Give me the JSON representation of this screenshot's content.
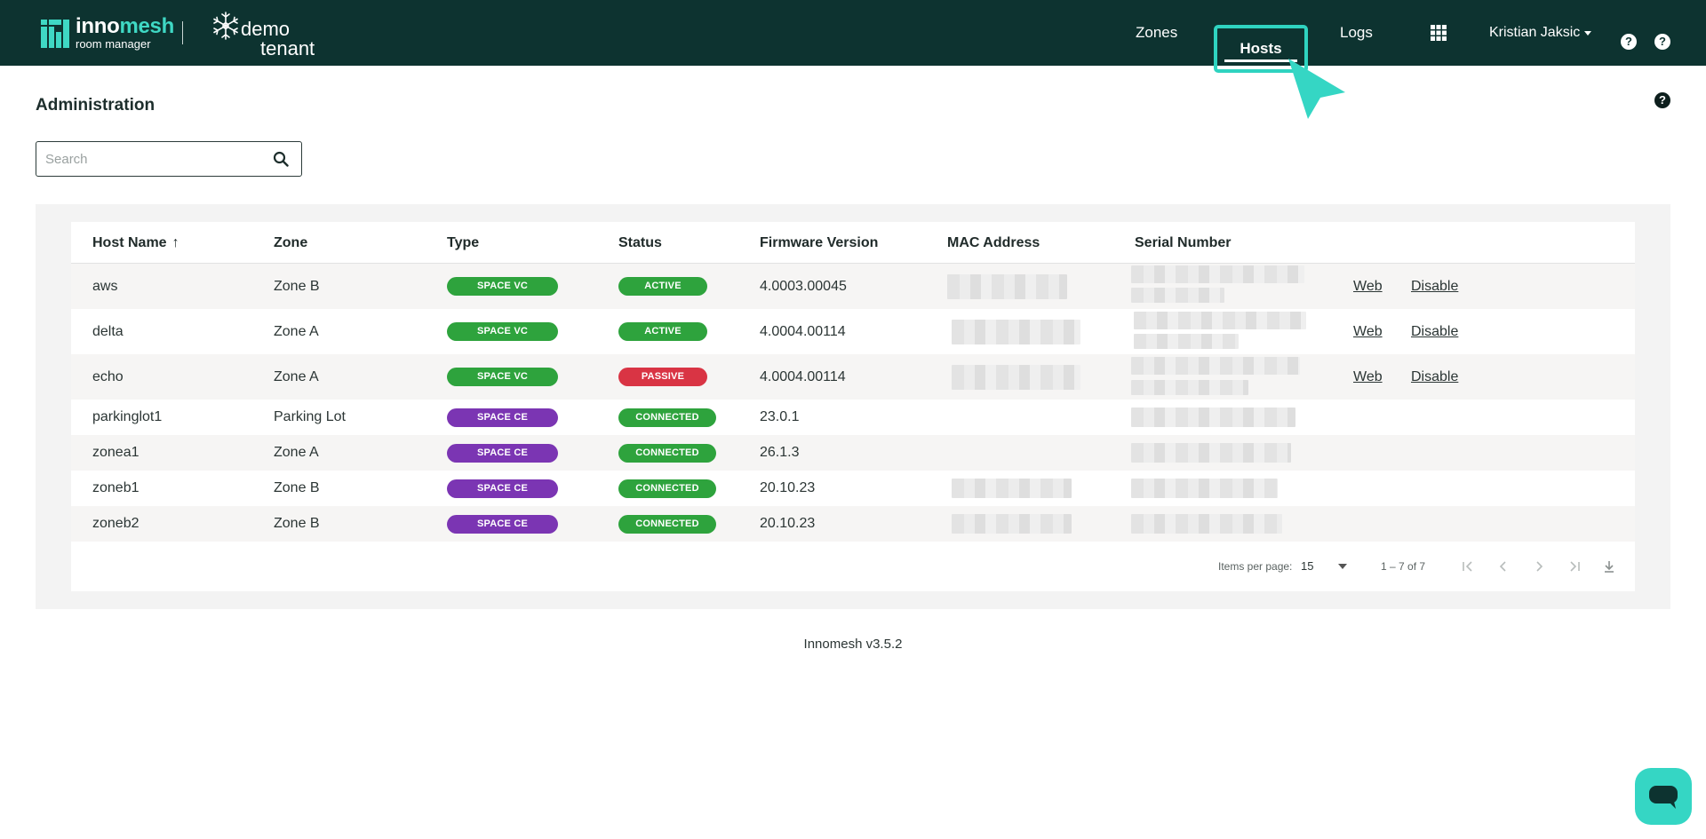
{
  "header": {
    "brand_name_part1": "inno",
    "brand_name_part2": "mesh",
    "brand_sub": "room manager",
    "tenant_line1": "demo",
    "tenant_line2": "tenant",
    "nav": {
      "zones": "Zones",
      "hosts": "Hosts",
      "logs": "Logs"
    },
    "user": "Kristian Jaksic",
    "help_glyph": "?"
  },
  "page": {
    "title": "Administration",
    "help_glyph": "?"
  },
  "search": {
    "placeholder": "Search",
    "value": ""
  },
  "table": {
    "columns": {
      "host_name": "Host Name",
      "sort_arrow": "↑",
      "zone": "Zone",
      "type": "Type",
      "status": "Status",
      "firmware": "Firmware Version",
      "mac": "MAC Address",
      "serial": "Serial Number"
    },
    "actions": {
      "web": "Web",
      "disable": "Disable"
    },
    "rows": [
      {
        "host": "aws",
        "zone": "Zone B",
        "type": "SPACE VC",
        "status": "ACTIVE",
        "firmware": "4.0003.00045"
      },
      {
        "host": "delta",
        "zone": "Zone A",
        "type": "SPACE VC",
        "status": "ACTIVE",
        "firmware": "4.0004.00114"
      },
      {
        "host": "echo",
        "zone": "Zone A",
        "type": "SPACE VC",
        "status": "PASSIVE",
        "firmware": "4.0004.00114"
      },
      {
        "host": "parkinglot1",
        "zone": "Parking Lot",
        "type": "SPACE CE",
        "status": "CONNECTED",
        "firmware": "23.0.1"
      },
      {
        "host": "zonea1",
        "zone": "Zone A",
        "type": "SPACE CE",
        "status": "CONNECTED",
        "firmware": "26.1.3"
      },
      {
        "host": "zoneb1",
        "zone": "Zone B",
        "type": "SPACE CE",
        "status": "CONNECTED",
        "firmware": "20.10.23"
      },
      {
        "host": "zoneb2",
        "zone": "Zone B",
        "type": "SPACE CE",
        "status": "CONNECTED",
        "firmware": "20.10.23"
      }
    ]
  },
  "paginator": {
    "items_per_page_label": "Items per page:",
    "items_per_page": "15",
    "range": "1 – 7 of 7"
  },
  "footer": {
    "version": "Innomesh v3.5.2"
  },
  "colors": {
    "header_bg": "#0d3330",
    "accent": "#3fd8c4",
    "badge_green": "#2ea33d",
    "badge_purple": "#7b35b3",
    "badge_red": "#d93444"
  },
  "icons": {
    "search": "search-icon",
    "apps": "apps-grid-icon",
    "help": "help-circle-icon",
    "chat": "chat-icon",
    "download": "download-icon"
  }
}
